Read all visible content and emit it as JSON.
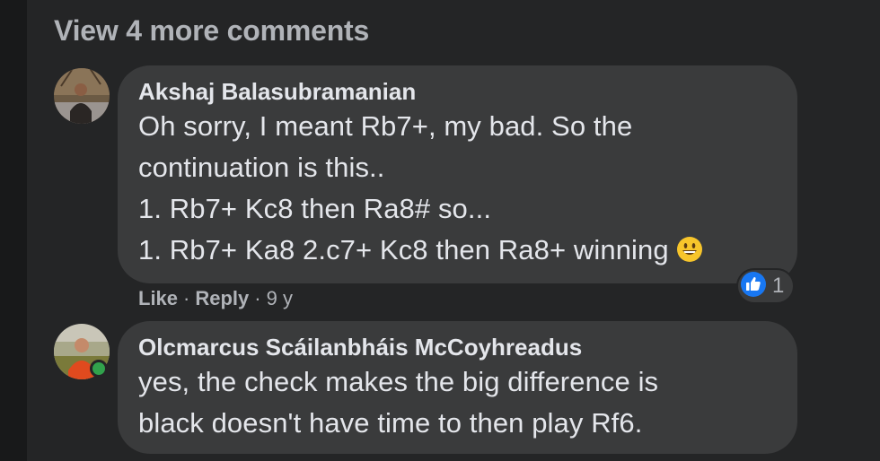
{
  "comments_section": {
    "view_more_label": "View 4 more comments"
  },
  "comments": [
    {
      "author": "Akshaj Balasubramanian",
      "lines": [
        "Oh sorry, I meant Rb7+, my bad. So the",
        "continuation is this..",
        "1. Rb7+ Kc8 then Ra8# so...",
        "1. Rb7+ Ka8 2.c7+ Kc8 then Ra8+ winning"
      ],
      "emoji": "grinning-face",
      "actions": {
        "like": "Like",
        "reply": "Reply",
        "time": "9 y"
      },
      "reaction": {
        "icon": "like-thumb-icon",
        "count": "1"
      }
    },
    {
      "author": "Olcmarcus Scáilanbháis McCoyhreadus",
      "lines": [
        "yes, the check makes the big difference is",
        "black doesn't have time to then play Rf6."
      ],
      "online": true
    }
  ],
  "colors": {
    "page_background": "#18191a",
    "panel_background": "#242526",
    "bubble_background": "#3a3b3c",
    "primary_text": "#e4e6eb",
    "secondary_text": "#b0b3b8",
    "like_blue": "#1877f2",
    "online_green": "#31a24c"
  }
}
